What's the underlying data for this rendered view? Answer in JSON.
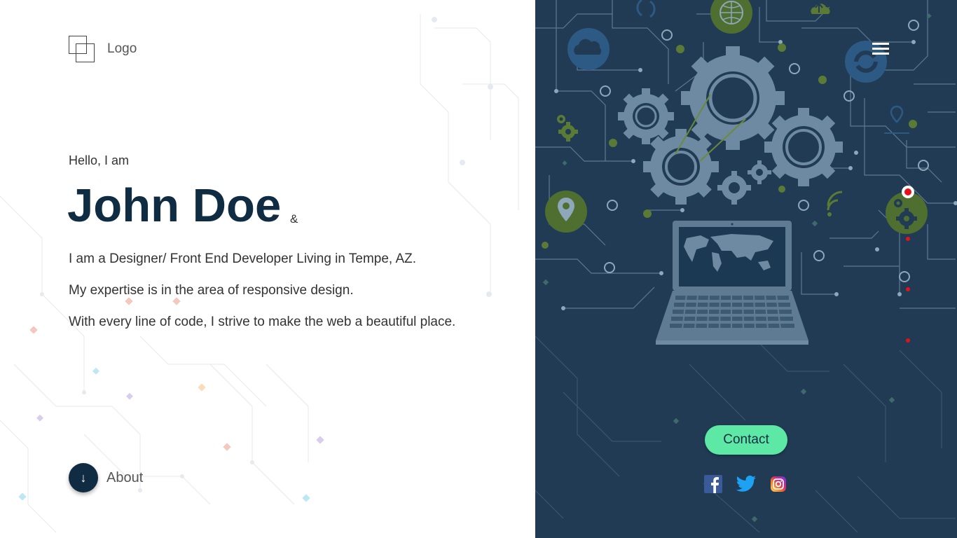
{
  "logo": {
    "label": "Logo"
  },
  "hero": {
    "greeting": "Hello,  I am",
    "name": "John Doe",
    "ampersand": "&",
    "lines": [
      "I am a Designer/ Front End Developer Living in Tempe, AZ.",
      "My expertise is in the area of responsive design.",
      "With every line of code, I strive to make the web a beautiful place."
    ]
  },
  "about": {
    "label": "About",
    "icon": "arrow-down-icon"
  },
  "nav": {
    "menu_icon": "hamburger-menu-icon"
  },
  "contact": {
    "label": "Contact"
  },
  "social": [
    {
      "name": "facebook-icon"
    },
    {
      "name": "twitter-icon"
    },
    {
      "name": "instagram-icon"
    }
  ],
  "colors": {
    "dark_navy": "#0f2c43",
    "panel_bg": "#213b54",
    "accent_green": "#5ee8a5",
    "indicator_red": "#e8101a"
  }
}
